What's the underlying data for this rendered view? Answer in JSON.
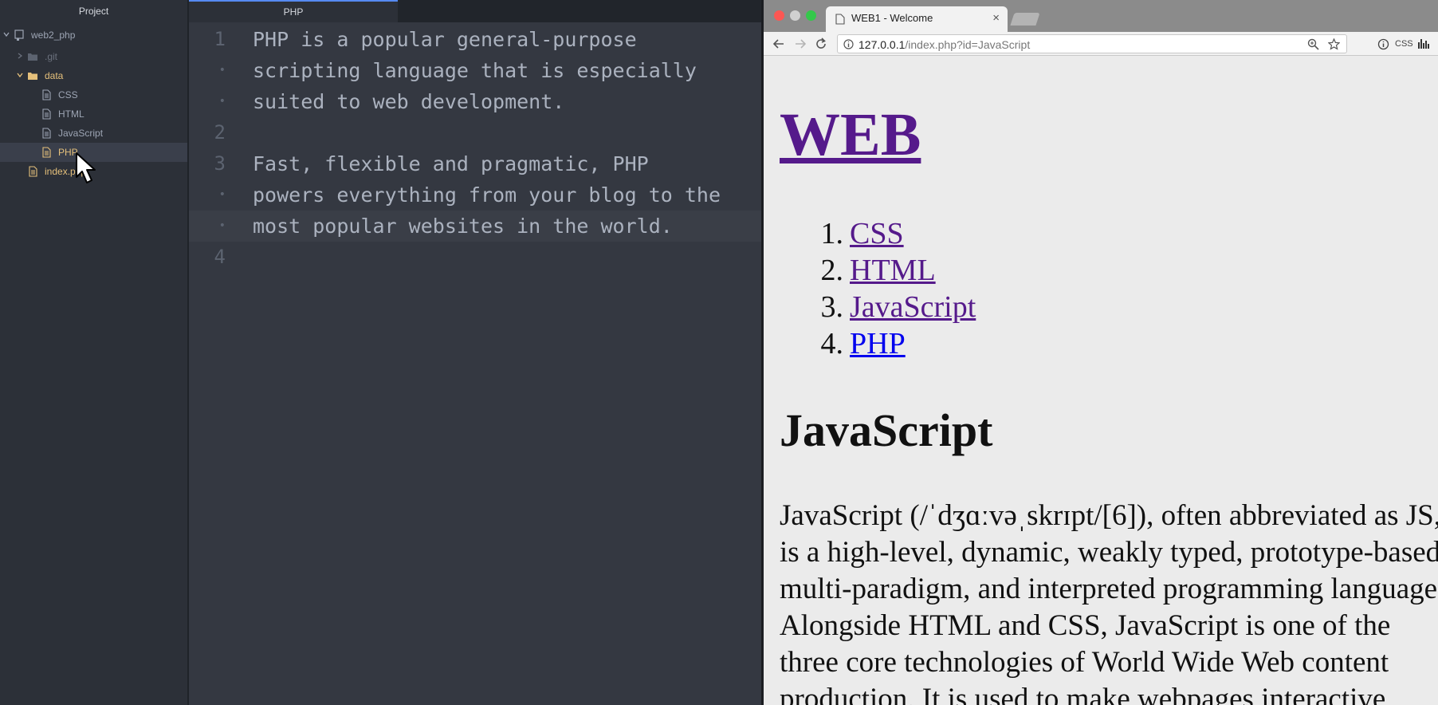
{
  "tree": {
    "header": "Project",
    "root": "web2_php",
    "items": [
      {
        "label": ".git"
      },
      {
        "label": "data"
      },
      {
        "label": "CSS"
      },
      {
        "label": "HTML"
      },
      {
        "label": "JavaScript"
      },
      {
        "label": "PHP"
      },
      {
        "label": "index.php"
      }
    ]
  },
  "editor": {
    "tab": "PHP",
    "lines": [
      {
        "gutter": "1",
        "text": "PHP is a popular general-purpose"
      },
      {
        "gutter": "•",
        "text": "scripting language that is especially"
      },
      {
        "gutter": "•",
        "text": "suited to web development."
      },
      {
        "gutter": "2",
        "text": ""
      },
      {
        "gutter": "3",
        "text": "Fast, flexible and pragmatic, PHP"
      },
      {
        "gutter": "•",
        "text": "powers everything from your blog to the"
      },
      {
        "gutter": "•",
        "text": "most popular websites in the world."
      },
      {
        "gutter": "4",
        "text": ""
      }
    ]
  },
  "browser": {
    "tab_title": "WEB1 - Welcome",
    "tab_close": "×",
    "url_host": "127.0.0.1",
    "url_path": "/index.php?id=JavaScript",
    "ext_css": "CSS",
    "page": {
      "site_title": "WEB",
      "nav": [
        {
          "num": "1.",
          "label": "CSS"
        },
        {
          "num": "2.",
          "label": "HTML"
        },
        {
          "num": "3.",
          "label": "JavaScript"
        },
        {
          "num": "4.",
          "label": "PHP"
        }
      ],
      "heading": "JavaScript",
      "body": [
        "JavaScript (/ˈdʒɑːvəˌskrɪpt/[6]), often abbreviated as JS,",
        "is a high-level, dynamic, weakly typed, prototype-based,",
        "multi-paradigm, and interpreted programming language.",
        "Alongside HTML and CSS, JavaScript is one of the",
        "three core technologies of World Wide Web content",
        "production. It is used to make webpages interactive"
      ]
    }
  },
  "colors": {
    "accent_tab": "#568af2",
    "visited_link": "#551a8b",
    "link": "#0000ee",
    "folder": "#e5c07b"
  }
}
